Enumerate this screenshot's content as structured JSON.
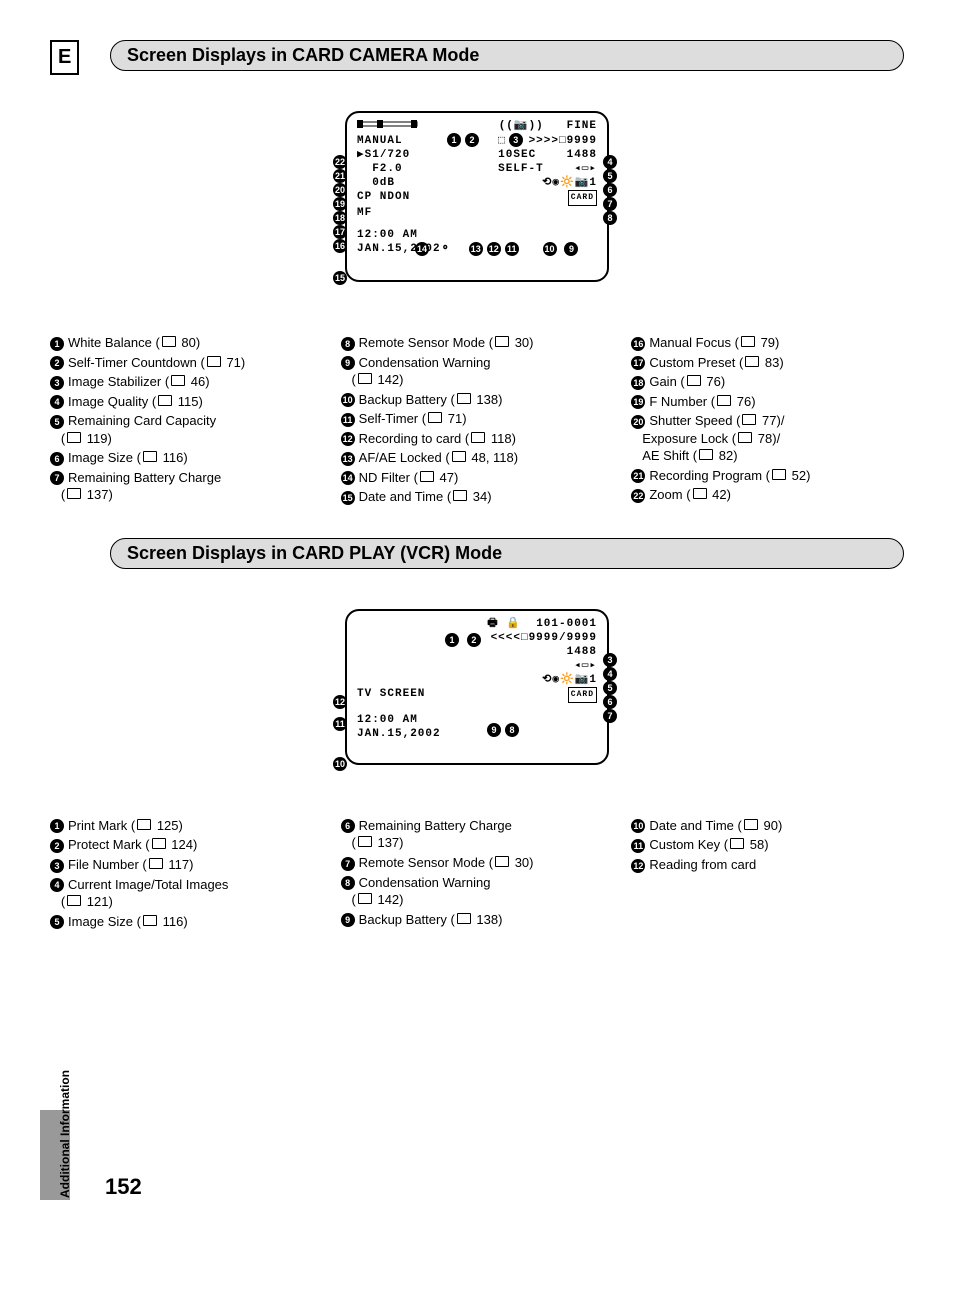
{
  "lang_tag": "E",
  "side_tab": "Additional Information",
  "page_number": "152",
  "section1": {
    "title": "Screen Displays in CARD CAMERA Mode",
    "screen": {
      "r1_right": "FINE",
      "r2_left": "MANUAL",
      "r2_right": ">>>>□9999",
      "r3_left": "▶S1/720",
      "r3_mid": "10SEC",
      "r3_right": "1488",
      "r4_left": "  F2.0",
      "r4_mid": "SELF-T",
      "r5_left": "  0dB",
      "r5_right": "1",
      "r6_left": "CP NDON",
      "r7_left": "MF",
      "r8_left": "12:00 AM",
      "r9_left": "JAN.15,2002"
    },
    "legend": [
      {
        "n": 1,
        "t": "White Balance",
        "p": "80"
      },
      {
        "n": 2,
        "t": "Self-Timer Countdown",
        "p": "71"
      },
      {
        "n": 3,
        "t": "Image Stabilizer",
        "p": "46"
      },
      {
        "n": 4,
        "t": "Image Quality",
        "p": "115"
      },
      {
        "n": 5,
        "t": "Remaining Card Capacity",
        "p": "119"
      },
      {
        "n": 6,
        "t": "Image Size",
        "p": "116"
      },
      {
        "n": 7,
        "t": "Remaining Battery Charge",
        "p": "137"
      },
      {
        "n": 8,
        "t": "Remote Sensor Mode",
        "p": "30"
      },
      {
        "n": 9,
        "t": "Condensation Warning",
        "p": "142"
      },
      {
        "n": 10,
        "t": "Backup Battery",
        "p": "138"
      },
      {
        "n": 11,
        "t": "Self-Timer",
        "p": "71"
      },
      {
        "n": 12,
        "t": "Recording to card",
        "p": "118"
      },
      {
        "n": 13,
        "t": "AF/AE Locked",
        "p": "48, 118"
      },
      {
        "n": 14,
        "t": "ND Filter",
        "p": "47"
      },
      {
        "n": 15,
        "t": "Date and Time",
        "p": "34"
      },
      {
        "n": 16,
        "t": "Manual Focus",
        "p": "79"
      },
      {
        "n": 17,
        "t": "Custom Preset",
        "p": "83"
      },
      {
        "n": 18,
        "t": "Gain",
        "p": "76"
      },
      {
        "n": 19,
        "t": "F Number",
        "p": "76"
      },
      {
        "n": 20,
        "t": "Shutter Speed",
        "p": "77",
        "extra1": "Exposure Lock",
        "extra1p": "78",
        "extra2": "AE Shift",
        "extra2p": "82"
      },
      {
        "n": 21,
        "t": "Recording Program",
        "p": "52"
      },
      {
        "n": 22,
        "t": "Zoom",
        "p": "42"
      }
    ]
  },
  "section2": {
    "title": "Screen Displays in CARD PLAY (VCR) Mode",
    "screen": {
      "r1_right": "101-0001",
      "r2_right": "<<<<□9999/9999",
      "r3_right": "1488",
      "r4_right": "1",
      "r5_left": "TV SCREEN",
      "r6_left": "12:00 AM",
      "r7_left": "JAN.15,2002"
    },
    "legend": [
      {
        "n": 1,
        "t": "Print Mark",
        "p": "125"
      },
      {
        "n": 2,
        "t": "Protect Mark",
        "p": "124"
      },
      {
        "n": 3,
        "t": "File Number",
        "p": "117"
      },
      {
        "n": 4,
        "t": "Current Image/Total Images",
        "p": "121"
      },
      {
        "n": 5,
        "t": "Image Size",
        "p": "116"
      },
      {
        "n": 6,
        "t": "Remaining Battery Charge",
        "p": "137"
      },
      {
        "n": 7,
        "t": "Remote Sensor Mode",
        "p": "30"
      },
      {
        "n": 8,
        "t": "Condensation Warning",
        "p": "142"
      },
      {
        "n": 9,
        "t": "Backup Battery",
        "p": "138"
      },
      {
        "n": 10,
        "t": "Date and Time",
        "p": "90"
      },
      {
        "n": 11,
        "t": "Custom Key",
        "p": "58"
      },
      {
        "n": 12,
        "t": "Reading from card"
      }
    ]
  }
}
